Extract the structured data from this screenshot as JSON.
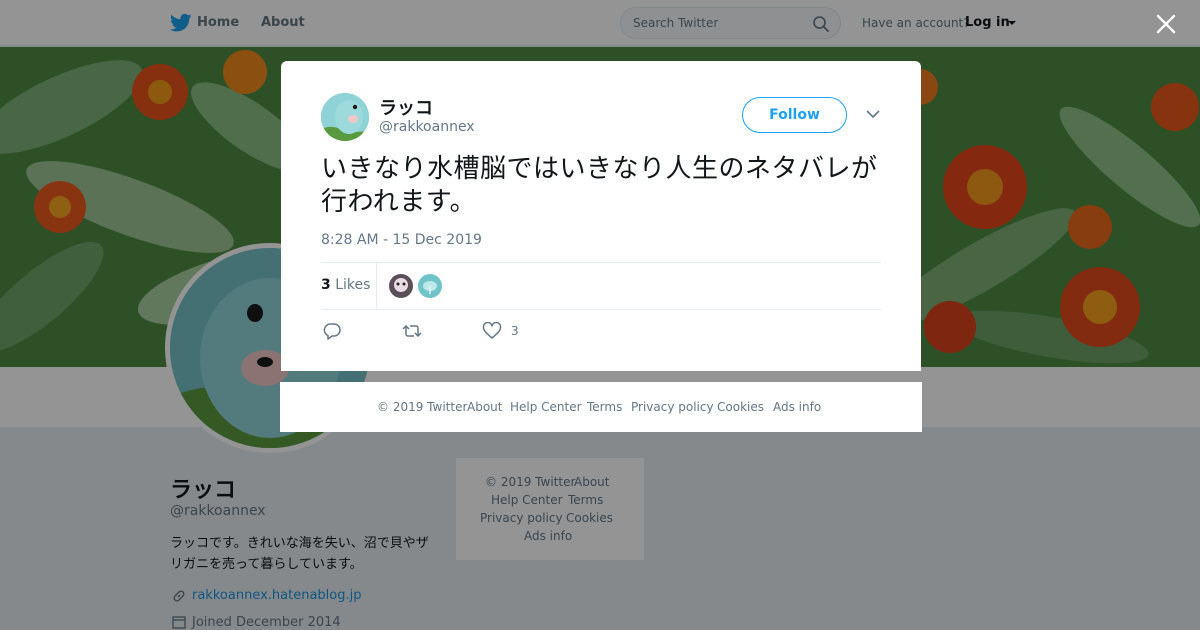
{
  "topbar": {
    "home_label": "Home",
    "about_label": "About",
    "search_placeholder": "Search Twitter",
    "have_account": "Have an account?",
    "login_label": "Log in"
  },
  "profile": {
    "name": "ラッコ",
    "handle": "@rakkoannex",
    "bio": "ラッコです。きれいな海を失い、沼で貝やザリガニを売って暮らしています。",
    "website": "rakkoannex.hatenablog.jp",
    "joined": "Joined December 2014"
  },
  "side_footer": {
    "copyright": "© 2019 Twitter",
    "about": "About",
    "help_center": "Help Center",
    "terms": "Terms",
    "privacy": "Privacy policy",
    "cookies": "Cookies",
    "ads_info": "Ads info"
  },
  "tweet": {
    "author_name": "ラッコ",
    "author_handle": "@rakkoannex",
    "follow_label": "Follow",
    "text": "いきなり水槽脳ではいきなり人生のネタバレが行われます。",
    "timestamp": "8:28 AM - 15 Dec 2019",
    "likes_count": "3",
    "likes_label": "Likes",
    "like_action_count": "3"
  },
  "modal_footer": {
    "copyright": "© 2019 Twitter",
    "about": "About",
    "help_center": "Help Center",
    "terms": "Terms",
    "privacy": "Privacy policy",
    "cookies": "Cookies",
    "ads_info": "Ads info"
  },
  "icons": {
    "logo": "twitter-bird-icon",
    "search": "search-icon",
    "close": "close-icon",
    "chevron": "chevron-down-icon",
    "reply": "reply-icon",
    "retweet": "retweet-icon",
    "like": "heart-icon",
    "link": "link-icon",
    "calendar": "calendar-icon"
  },
  "colors": {
    "brand_blue": "#1da1f2",
    "link_blue": "#1b95e0",
    "muted_text": "#657786",
    "overlay": "rgba(0,0,0,0.42)"
  }
}
